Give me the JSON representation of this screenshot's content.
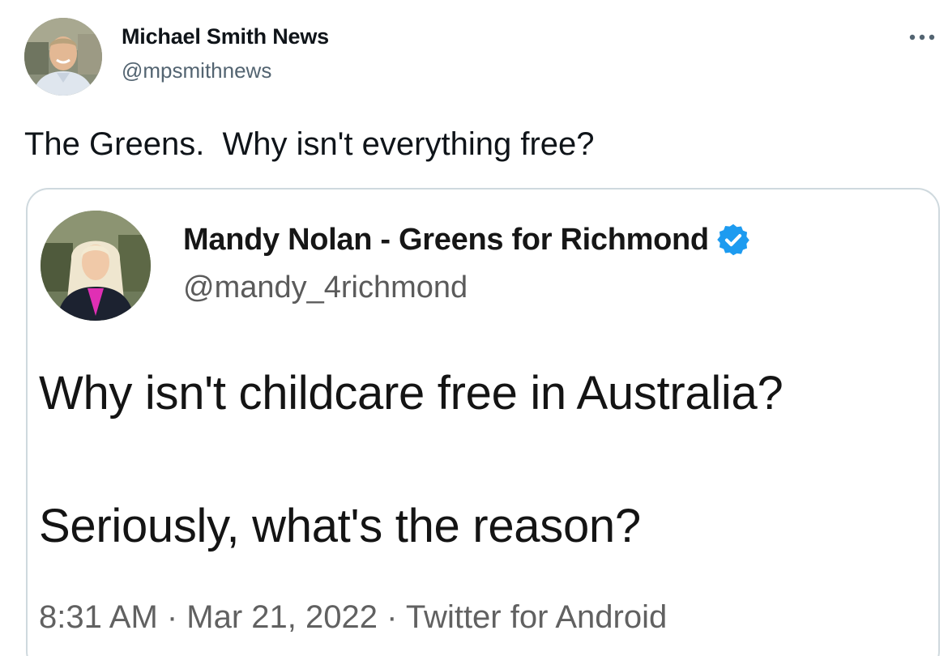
{
  "tweet": {
    "author": {
      "name": "Michael Smith News",
      "handle": "@mpsmithnews"
    },
    "text": "The Greens.  Why isn't everything free?",
    "more_icon": "more-horizontal-icon"
  },
  "quoted_tweet": {
    "author": {
      "name": "Mandy Nolan - Greens for Richmond",
      "handle": "@mandy_4richmond",
      "verified": true,
      "verified_icon": "verified-badge-icon",
      "verified_color": "#1d9bf0"
    },
    "line1": "Why isn't childcare free in Australia?",
    "line2": "Seriously, what's the reason?",
    "meta": "8:31 AM · Mar 21, 2022 · Twitter for Android"
  },
  "colors": {
    "text_primary": "#0f1419",
    "text_secondary": "#536471",
    "border": "#cfd9de"
  }
}
